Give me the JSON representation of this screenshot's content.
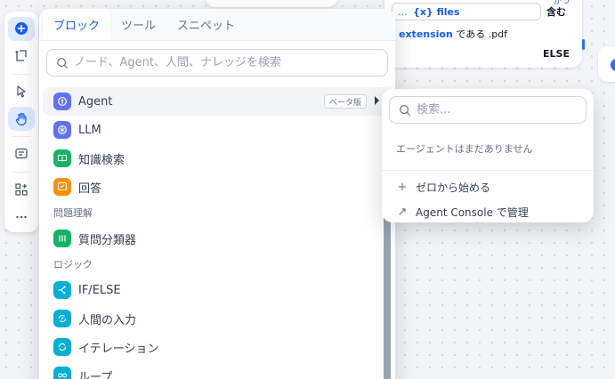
{
  "canvas": {
    "ifelse_node": {
      "var_dots": "…",
      "var_name": "{x} files",
      "op_top": "かつ",
      "op": "含む",
      "cond_keyword": "extension",
      "cond_text": " である .pdf",
      "else_label": "ELSE"
    }
  },
  "toolbar": {
    "items": [
      {
        "name": "add-node",
        "icon": "plus-circle-icon"
      },
      {
        "name": "add-note",
        "icon": "note-add-icon"
      },
      {
        "name": "pointer",
        "icon": "cursor-icon"
      },
      {
        "name": "hand",
        "icon": "hand-icon"
      },
      {
        "name": "comment",
        "icon": "comment-icon"
      },
      {
        "name": "organize",
        "icon": "grid-icon"
      },
      {
        "name": "more",
        "icon": "more-icon"
      }
    ]
  },
  "block_panel": {
    "tabs": [
      "ブロック",
      "ツール",
      "スニペット"
    ],
    "active_tab": "ブロック",
    "search_placeholder": "ノード、Agent、人間、ナレッジを検索",
    "items": [
      {
        "label": "Agent",
        "badge": "ベータ版",
        "color": "#6172f3",
        "icon": "agent-icon"
      },
      {
        "label": "LLM",
        "color": "#6172f3",
        "icon": "llm-icon"
      },
      {
        "label": "知識検索",
        "color": "#16b364",
        "icon": "book-icon"
      },
      {
        "label": "回答",
        "color": "#f79009",
        "icon": "answer-icon"
      }
    ],
    "section_question": "問題理解",
    "items_question": [
      {
        "label": "質問分類器",
        "color": "#16b364",
        "icon": "classifier-icon"
      }
    ],
    "section_logic": "ロジック",
    "items_logic": [
      {
        "label": "IF/ELSE",
        "color": "#06aed4",
        "icon": "branch-icon"
      },
      {
        "label": "人間の入力",
        "color": "#06aed4",
        "icon": "human-icon"
      },
      {
        "label": "イテレーション",
        "color": "#06aed4",
        "icon": "iteration-icon"
      },
      {
        "label": "ループ",
        "color": "#06aed4",
        "icon": "loop-icon"
      }
    ]
  },
  "agent_panel": {
    "search_placeholder": "検索...",
    "empty_text": "エージェントはまだありません",
    "actions": [
      {
        "label": "ゼロから始める",
        "icon": "+"
      },
      {
        "label": "Agent Console で管理",
        "icon": "↗"
      }
    ]
  }
}
